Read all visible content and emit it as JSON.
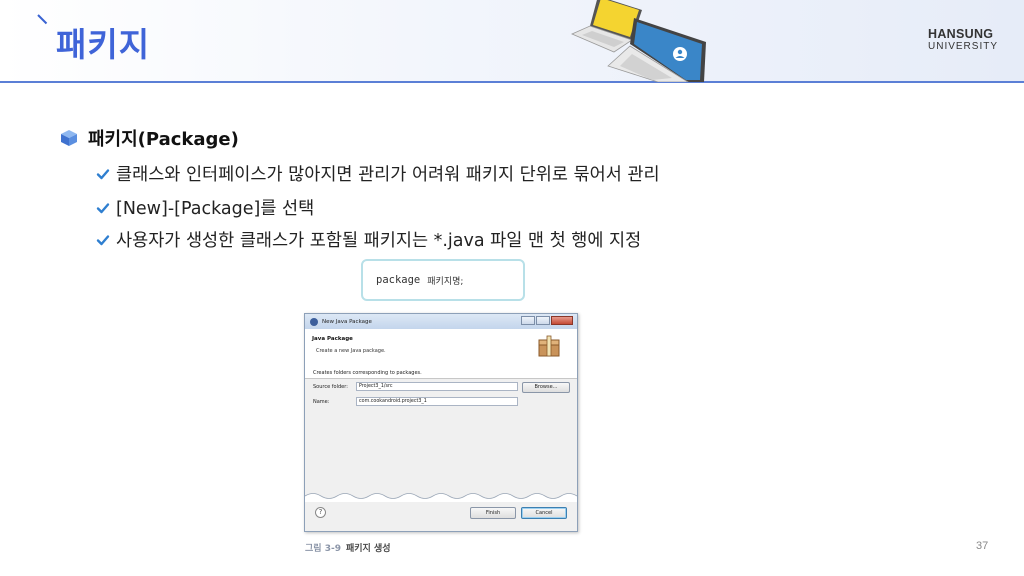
{
  "header": {
    "title": "패키지",
    "logo_top": "HANSUNG",
    "logo_bottom": "UNIVERSITY"
  },
  "bullets": {
    "main": "패키지(Package)",
    "items": [
      "클래스와 인터페이스가 많아지면 관리가 어려워 패키지 단위로 묶어서 관리",
      "[New]-[Package]를 선택",
      "사용자가 생성한 클래스가 포함될 패키지는 *.java 파일 맨 첫 행에 지정"
    ]
  },
  "code": {
    "keyword": "package",
    "name": "패키지명;"
  },
  "dialog": {
    "window_title": "New Java Package",
    "header_title": "Java Package",
    "header_subtitle": "Create a new Java package.",
    "description": "Creates folders corresponding to packages.",
    "source_folder_label": "Source folder:",
    "source_folder_value": "Project3_1/src",
    "browse_label": "Browse...",
    "name_label": "Name:",
    "name_value": "com.cookandroid.project3_1",
    "help_label": "?",
    "finish_label": "Finish",
    "cancel_label": "Cancel"
  },
  "caption": {
    "figure": "그림 3-9",
    "text": "패키지 생성"
  },
  "page_number": "37",
  "colors": {
    "title": "#3f64d8",
    "header_line": "#5b7fd6",
    "check": "#2f7fd0"
  }
}
